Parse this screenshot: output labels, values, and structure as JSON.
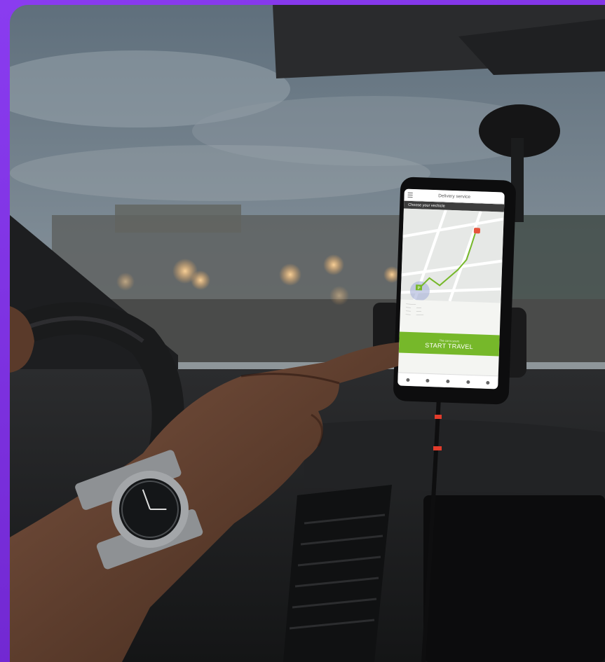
{
  "scene": {
    "description_hidden": "",
    "frame_color": "#7b2fd6"
  },
  "phone": {
    "header_title": "Delivery service",
    "subheader": "Choose your vechicle",
    "cta_small": "The car is yours",
    "cta_big": "START TRAVEL",
    "accent_color": "#76b82a",
    "marker_start": "P",
    "icons": [
      "menu-icon",
      "search-icon",
      "map-pin-icon",
      "parking-icon"
    ]
  }
}
